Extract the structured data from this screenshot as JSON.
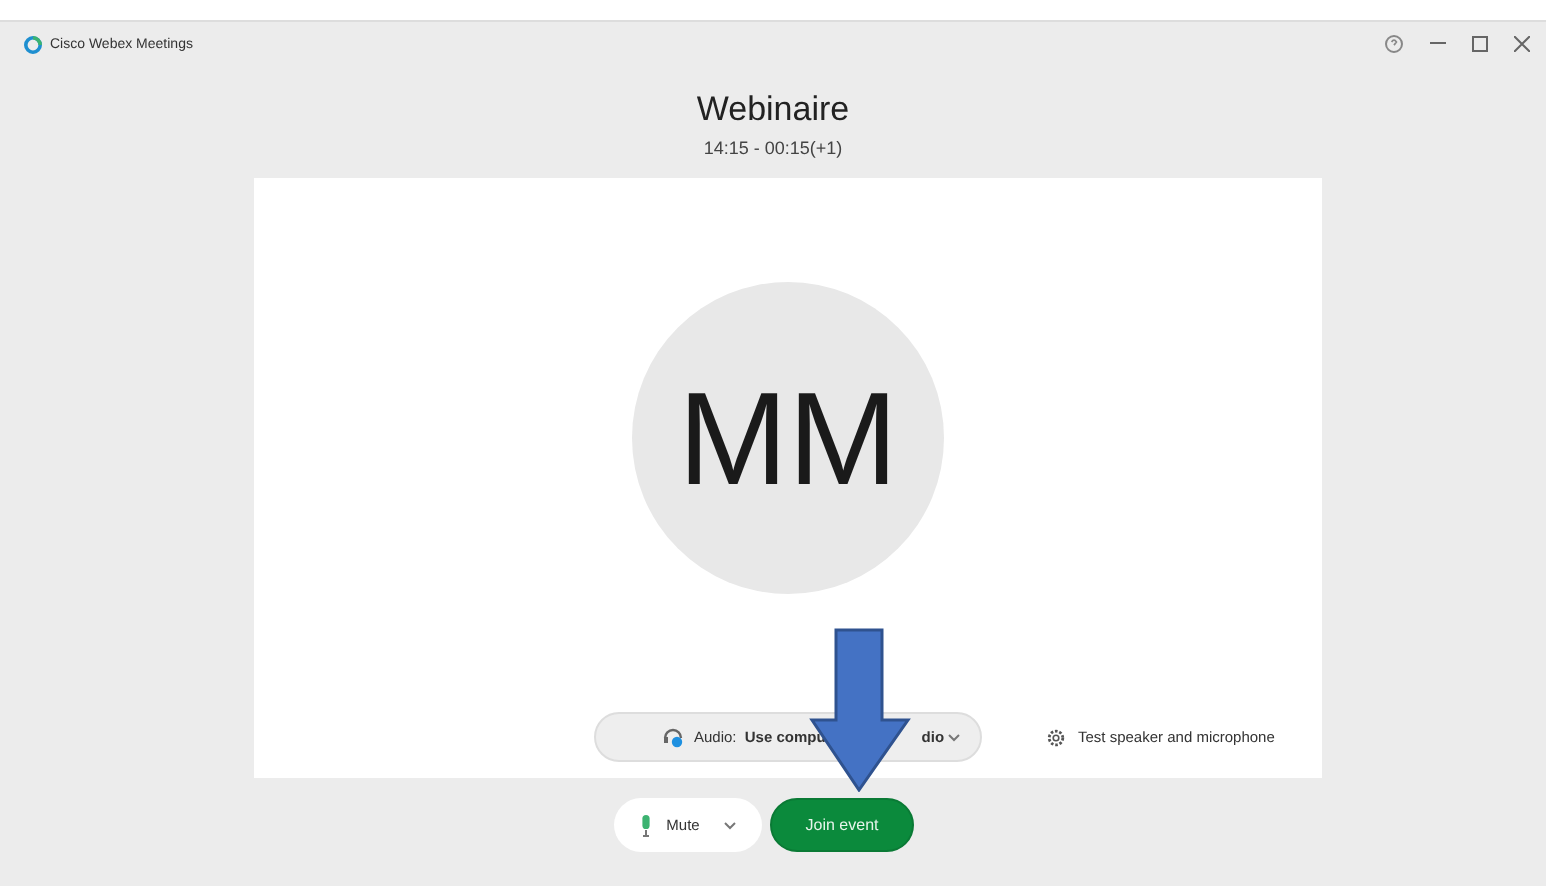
{
  "window": {
    "title": "Cisco Webex Meetings"
  },
  "meeting": {
    "title": "Webinaire",
    "time": "14:15 - 00:15(+1)"
  },
  "avatar": {
    "initials": "MM"
  },
  "audio": {
    "label": "Audio:",
    "value_parts": [
      "Use compu",
      "dio"
    ]
  },
  "test_link": "Test speaker and microphone",
  "mute_button": "Mute",
  "join_button": "Join event"
}
